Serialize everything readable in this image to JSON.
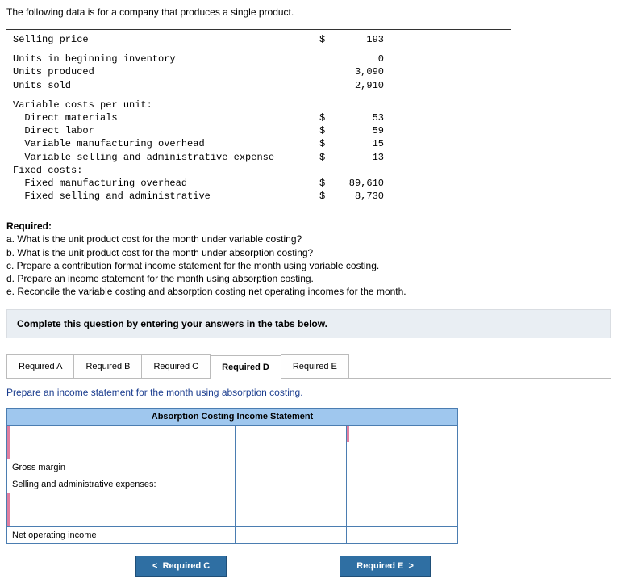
{
  "intro": "The following data is for a company that produces a single product.",
  "rows": {
    "selling_price": {
      "label": "Selling price",
      "cur": "$",
      "val": "193"
    },
    "beg_inv": {
      "label": "Units in beginning inventory",
      "cur": "",
      "val": "0"
    },
    "produced": {
      "label": "Units produced",
      "cur": "",
      "val": "3,090"
    },
    "sold": {
      "label": "Units sold",
      "cur": "",
      "val": "2,910"
    },
    "var_header": {
      "label": "Variable costs per unit:"
    },
    "dm": {
      "label": "  Direct materials",
      "cur": "$",
      "val": "53"
    },
    "dl": {
      "label": "  Direct labor",
      "cur": "$",
      "val": "59"
    },
    "vmo": {
      "label": "  Variable manufacturing overhead",
      "cur": "$",
      "val": "15"
    },
    "vsa": {
      "label": "  Variable selling and administrative expense",
      "cur": "$",
      "val": "13"
    },
    "fixed_header": {
      "label": "Fixed costs:"
    },
    "fmo": {
      "label": "  Fixed manufacturing overhead",
      "cur": "$",
      "val": "89,610"
    },
    "fsa": {
      "label": "  Fixed selling and administrative",
      "cur": "$",
      "val": "8,730"
    }
  },
  "required": {
    "title": "Required:",
    "a": "a. What is the unit product cost for the month under variable costing?",
    "b": "b. What is the unit product cost for the month under absorption costing?",
    "c": "c. Prepare a contribution format income statement for the month using variable costing.",
    "d": "d. Prepare an income statement for the month using absorption costing.",
    "e": "e. Reconcile the variable costing and absorption costing net operating incomes for the month."
  },
  "instruction_bar": "Complete this question by entering your answers in the tabs below.",
  "tabs": {
    "a": "Required A",
    "b": "Required B",
    "c": "Required C",
    "d": "Required D",
    "e": "Required E"
  },
  "tab_instruction": "Prepare an income statement for the month using absorption costing.",
  "ac_header": "Absorption Costing Income Statement",
  "ac_rows": {
    "gross_margin": "Gross margin",
    "sae": "Selling and administrative expenses:",
    "noi": "Net operating income"
  },
  "nav": {
    "prev": "Required C",
    "next": "Required E"
  },
  "chart_data": {
    "type": "table",
    "title": "Product cost data",
    "rows": [
      {
        "item": "Selling price",
        "value": 193,
        "unit": "$"
      },
      {
        "item": "Units in beginning inventory",
        "value": 0
      },
      {
        "item": "Units produced",
        "value": 3090
      },
      {
        "item": "Units sold",
        "value": 2910
      },
      {
        "item": "Direct materials (per unit)",
        "value": 53,
        "unit": "$"
      },
      {
        "item": "Direct labor (per unit)",
        "value": 59,
        "unit": "$"
      },
      {
        "item": "Variable manufacturing overhead (per unit)",
        "value": 15,
        "unit": "$"
      },
      {
        "item": "Variable selling and administrative expense (per unit)",
        "value": 13,
        "unit": "$"
      },
      {
        "item": "Fixed manufacturing overhead",
        "value": 89610,
        "unit": "$"
      },
      {
        "item": "Fixed selling and administrative",
        "value": 8730,
        "unit": "$"
      }
    ]
  }
}
